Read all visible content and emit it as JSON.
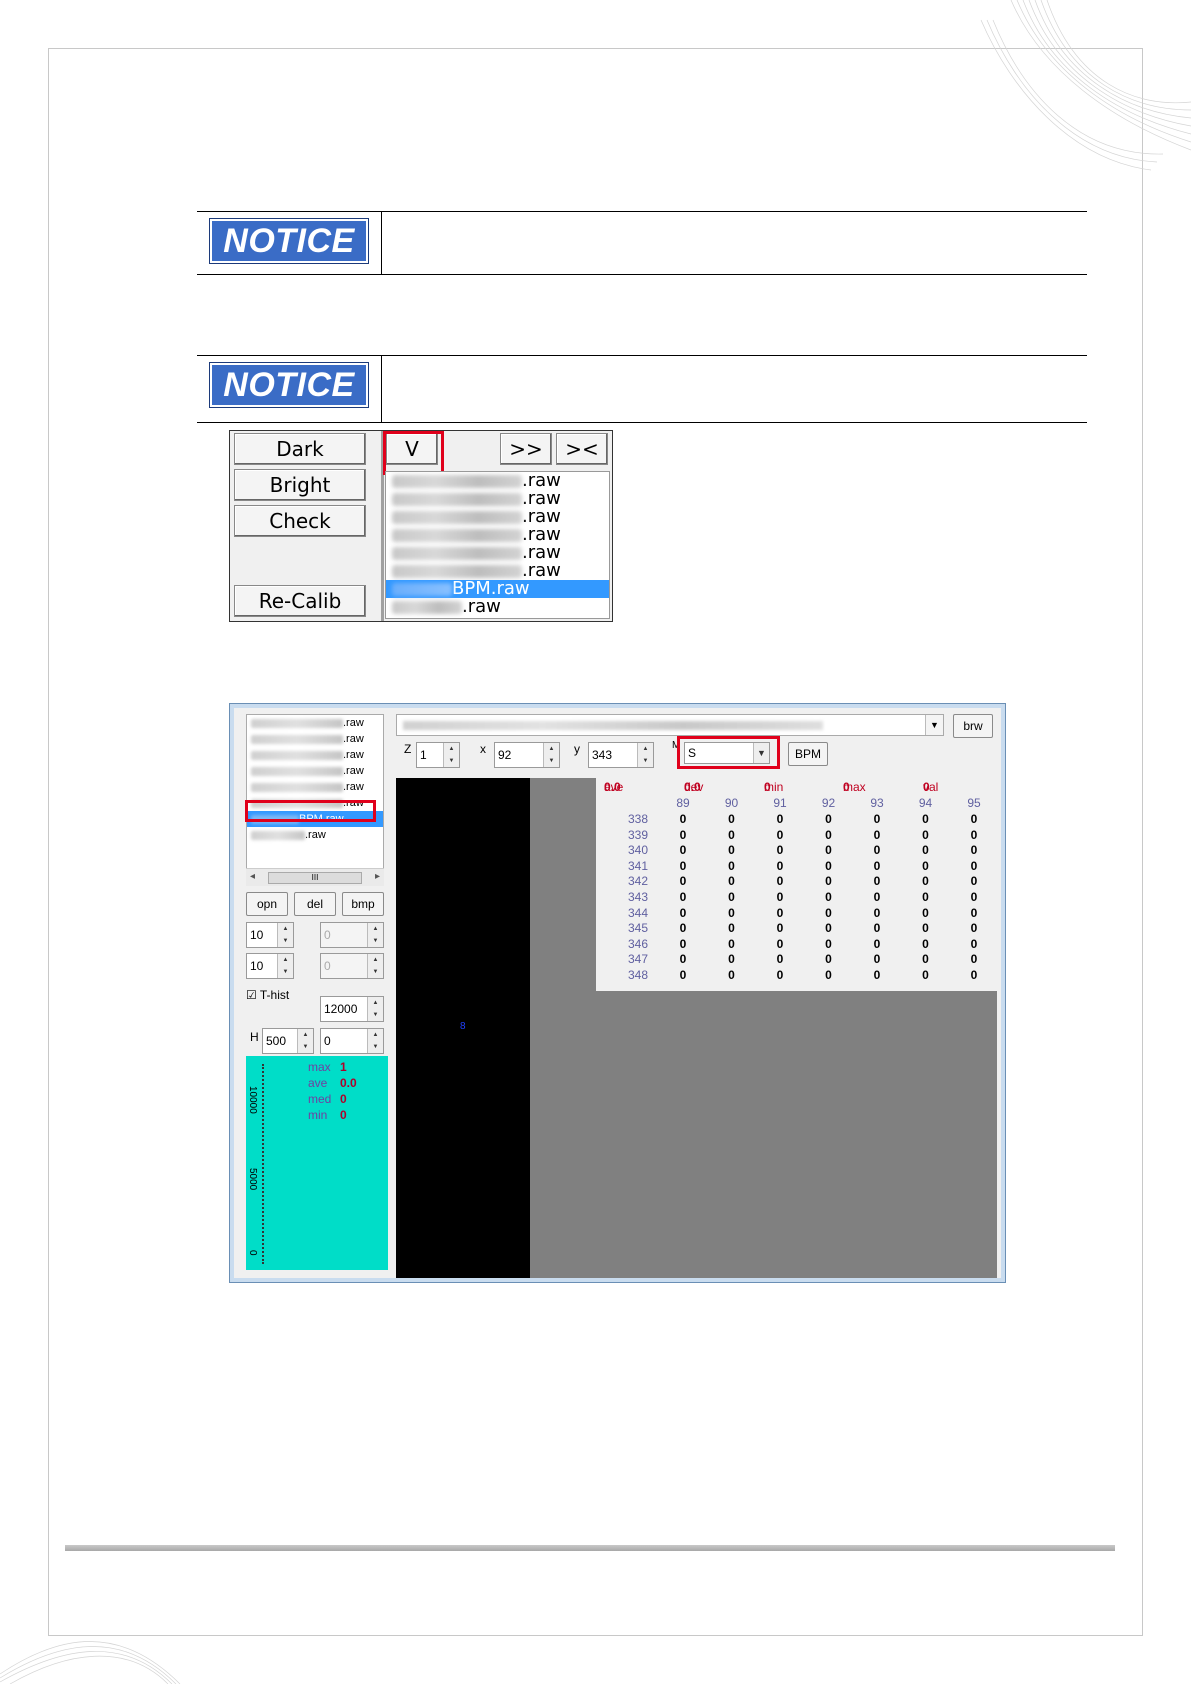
{
  "notices": [
    {
      "label": "NOTICE"
    },
    {
      "label": "NOTICE"
    }
  ],
  "panel1": {
    "left_buttons": [
      "Dark",
      "Bright",
      "Check",
      "Re-Calib"
    ],
    "top_buttons": [
      "V",
      ">>",
      "><"
    ],
    "files": [
      {
        "suffix": ".raw",
        "selected": false
      },
      {
        "suffix": ".raw",
        "selected": false
      },
      {
        "suffix": ".raw",
        "selected": false
      },
      {
        "suffix": ".raw",
        "selected": false
      },
      {
        "suffix": ".raw",
        "selected": false
      },
      {
        "suffix": ".raw",
        "selected": false
      },
      {
        "suffix": "BPM.raw",
        "selected": true
      },
      {
        "suffix": ".raw",
        "selected": false
      }
    ]
  },
  "window": {
    "files": [
      {
        "suffix": ".raw"
      },
      {
        "suffix": ".raw"
      },
      {
        "suffix": ".raw"
      },
      {
        "suffix": ".raw"
      },
      {
        "suffix": ".raw"
      },
      {
        "suffix": ".raw"
      },
      {
        "suffix": "BPM.raw"
      },
      {
        "suffix": ".raw"
      }
    ],
    "scroll_thumb": "III",
    "buttons": {
      "opn": "opn",
      "del": "del",
      "bmp": "bmp",
      "brw": "brw",
      "bpm": "BPM"
    },
    "spin1a": "10",
    "spin1b": "0",
    "spin2a": "10",
    "spin2b": "0",
    "thist_label": "T-hist",
    "thist_value": "12000",
    "h_label": "H",
    "h_value": "500",
    "h_value2": "0",
    "z_label": "Z",
    "z_value": "1",
    "x_label": "x",
    "x_value": "92",
    "y_label": "y",
    "y_value": "343",
    "m_label": "M",
    "m_value": "S",
    "hist_axis": [
      "10000",
      "5000",
      "0"
    ],
    "hist_stats": [
      {
        "k": "max",
        "v": "1"
      },
      {
        "k": "ave",
        "v": "0.0"
      },
      {
        "k": "med",
        "v": "0"
      },
      {
        "k": "min",
        "v": "0"
      }
    ],
    "summary": [
      {
        "k": "ave",
        "v": "0.0"
      },
      {
        "k": "dev",
        "v": "0.0"
      },
      {
        "k": "min",
        "v": "0"
      },
      {
        "k": "max",
        "v": "0"
      },
      {
        "k": "val",
        "v": "0"
      }
    ],
    "columns": [
      "89",
      "90",
      "91",
      "92",
      "93",
      "94",
      "95"
    ],
    "rows": [
      "338",
      "339",
      "340",
      "341",
      "342",
      "343",
      "344",
      "345",
      "346",
      "347",
      "348"
    ],
    "cell_value": "0",
    "viewer_mark": "8"
  }
}
